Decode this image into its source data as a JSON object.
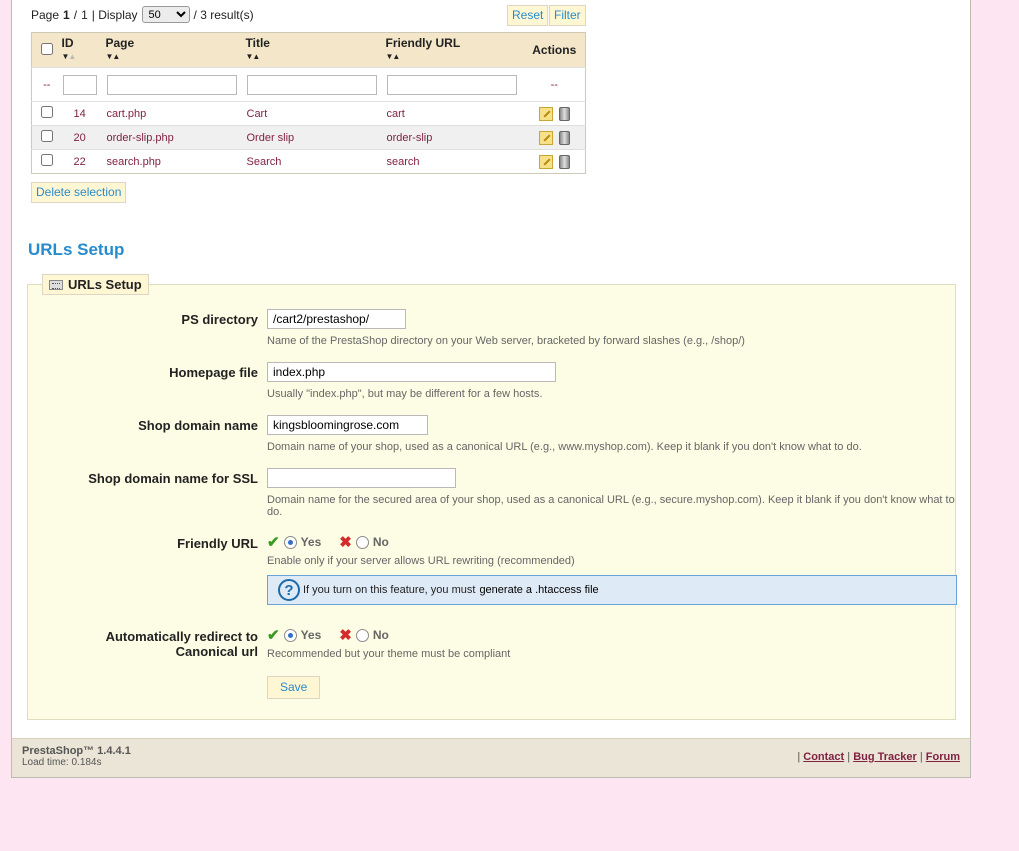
{
  "pager": {
    "page_prefix": "Page",
    "page_current": "1",
    "page_sep": "/",
    "page_total": "1",
    "display_label": "| Display",
    "per_page": "50",
    "results": "/ 3 result(s)"
  },
  "toolbar": {
    "reset_label": "Reset",
    "filter_label": "Filter",
    "delete_selection_label": "Delete selection"
  },
  "table": {
    "columns": {
      "id": "ID",
      "page": "Page",
      "title": "Title",
      "friendly_url": "Friendly URL",
      "actions": "Actions"
    },
    "filter_placeholder": "--",
    "rows": [
      {
        "id": "14",
        "page": "cart.php",
        "title": "Cart",
        "friendly_url": "cart"
      },
      {
        "id": "20",
        "page": "order-slip.php",
        "title": "Order slip",
        "friendly_url": "order-slip"
      },
      {
        "id": "22",
        "page": "search.php",
        "title": "Search",
        "friendly_url": "search"
      }
    ]
  },
  "urls_setup": {
    "section_title": "URLs Setup",
    "legend": "URLs Setup",
    "ps_directory": {
      "label": "PS directory",
      "value": "/cart2/prestashop/",
      "hint": "Name of the PrestaShop directory on your Web server, bracketed by forward slashes (e.g., /shop/)"
    },
    "homepage_file": {
      "label": "Homepage file",
      "value": "index.php",
      "hint": "Usually \"index.php\", but may be different for a few hosts."
    },
    "shop_domain": {
      "label": "Shop domain name",
      "value": "kingsbloomingrose.com",
      "hint": "Domain name of your shop, used as a canonical URL (e.g., www.myshop.com). Keep it blank if you don't know what to do."
    },
    "shop_domain_ssl": {
      "label": "Shop domain name for SSL",
      "value": "",
      "hint": "Domain name for the secured area of your shop, used as a canonical URL (e.g., secure.myshop.com). Keep it blank if you don't know what to do."
    },
    "friendly_url": {
      "label": "Friendly URL",
      "yes": "Yes",
      "no": "No",
      "selected": "Yes",
      "hint": "Enable only if your server allows URL rewriting (recommended)",
      "info_prefix": "If you turn on this feature, you must",
      "info_link": "generate a .htaccess file"
    },
    "canonical_redirect": {
      "label_line1": "Automatically redirect to",
      "label_line2": "Canonical url",
      "yes": "Yes",
      "no": "No",
      "selected": "Yes",
      "hint": "Recommended but your theme must be compliant"
    },
    "save_label": "Save"
  },
  "footer": {
    "version": "PrestaShop™ 1.4.4.1",
    "load_time": "Load time: 0.184s",
    "contact": "Contact",
    "bug_tracker": "Bug Tracker",
    "forum": "Forum"
  },
  "colors": {
    "background": "#fde6f2",
    "accent": "#268ccd",
    "table_header": "#f4e6c9",
    "link": "#812143"
  }
}
